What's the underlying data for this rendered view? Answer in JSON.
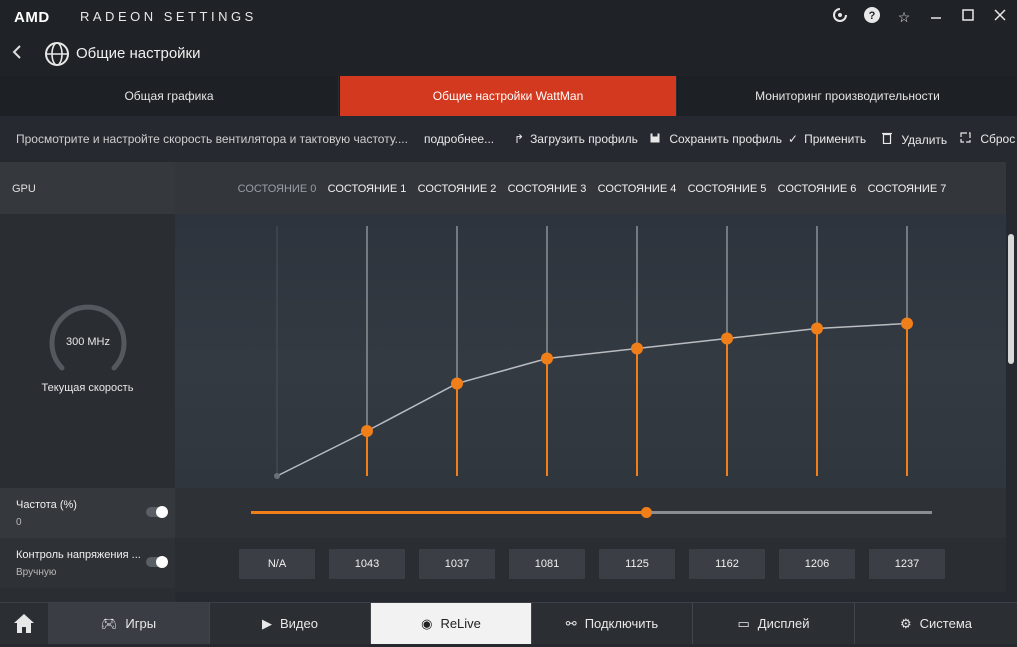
{
  "window": {
    "brand": "AMD",
    "title": "RADEON SETTINGS"
  },
  "header": {
    "page_title": "Общие настройки"
  },
  "tabs": [
    {
      "label": "Общая графика",
      "active": false
    },
    {
      "label": "Общие настройки WattMan",
      "active": true
    },
    {
      "label": "Мониторинг производительности",
      "active": false
    }
  ],
  "toolbar": {
    "description": "Просмотрите и настройте скорость вентилятора и тактовую частоту....",
    "more": "подробнее...",
    "load_profile": "Загрузить профиль",
    "save_profile": "Сохранить профиль",
    "apply": "Применить",
    "delete": "Удалить",
    "reset": "Сброс"
  },
  "gpu": {
    "label": "GPU",
    "current_speed_value": "300 MHz",
    "current_speed_label": "Текущая скорость"
  },
  "frequency": {
    "label": "Частота (%)",
    "value": "0",
    "toggle_on": true,
    "slider_fraction": 0.58
  },
  "voltage": {
    "label": "Контроль напряжения ...",
    "mode": "Вручную",
    "toggle_on": true
  },
  "chart_data": {
    "type": "line",
    "categories": [
      "СОСТОЯНИЕ 0",
      "СОСТОЯНИЕ 1",
      "СОСТОЯНИЕ 2",
      "СОСТОЯНИЕ 3",
      "СОСТОЯНИЕ 4",
      "СОСТОЯНИЕ 5",
      "СОСТОЯНИЕ 6",
      "СОСТОЯНИЕ 7"
    ],
    "enabled": [
      false,
      true,
      true,
      true,
      true,
      true,
      true,
      true
    ],
    "values": [
      0,
      18,
      37,
      47,
      51,
      55,
      59,
      61
    ],
    "ylim": [
      0,
      100
    ],
    "voltages": [
      "N/A",
      "1043",
      "1037",
      "1081",
      "1125",
      "1162",
      "1206",
      "1237"
    ],
    "accent": "#f07f1a",
    "line_color": "#b9bcc0",
    "grid": false
  },
  "bottom_nav": [
    {
      "label": "Игры",
      "icon": "gamepad-icon"
    },
    {
      "label": "Видео",
      "icon": "play-icon"
    },
    {
      "label": "ReLive",
      "icon": "relive-icon"
    },
    {
      "label": "Подключить",
      "icon": "connect-icon"
    },
    {
      "label": "Дисплей",
      "icon": "display-icon"
    },
    {
      "label": "Система",
      "icon": "gear-icon"
    }
  ]
}
